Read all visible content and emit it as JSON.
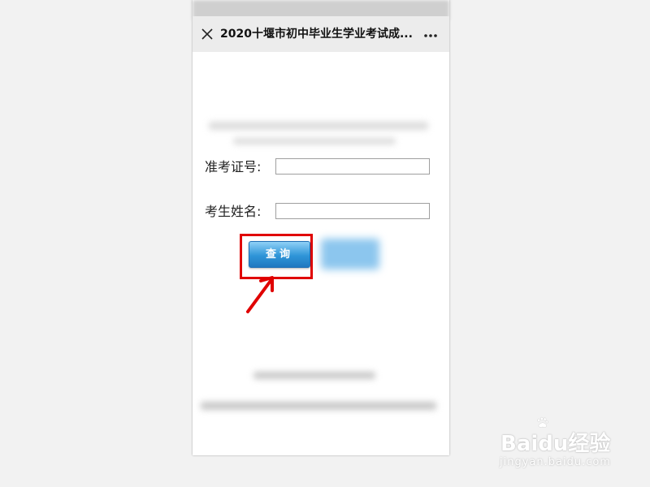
{
  "titlebar": {
    "title": "2020十堰市初中毕业生学业考试成...",
    "close_icon": "close-icon",
    "more_icon": "more-icon"
  },
  "form": {
    "ticket_label": "准考证号:",
    "ticket_value": "",
    "name_label": "考生姓名:",
    "name_value": "",
    "query_button": "查询"
  },
  "watermark": {
    "brand": "Baidu经验",
    "url": "jingyan.baidu.com"
  },
  "colors": {
    "highlight": "#e00000",
    "button": "#2f95d8"
  }
}
